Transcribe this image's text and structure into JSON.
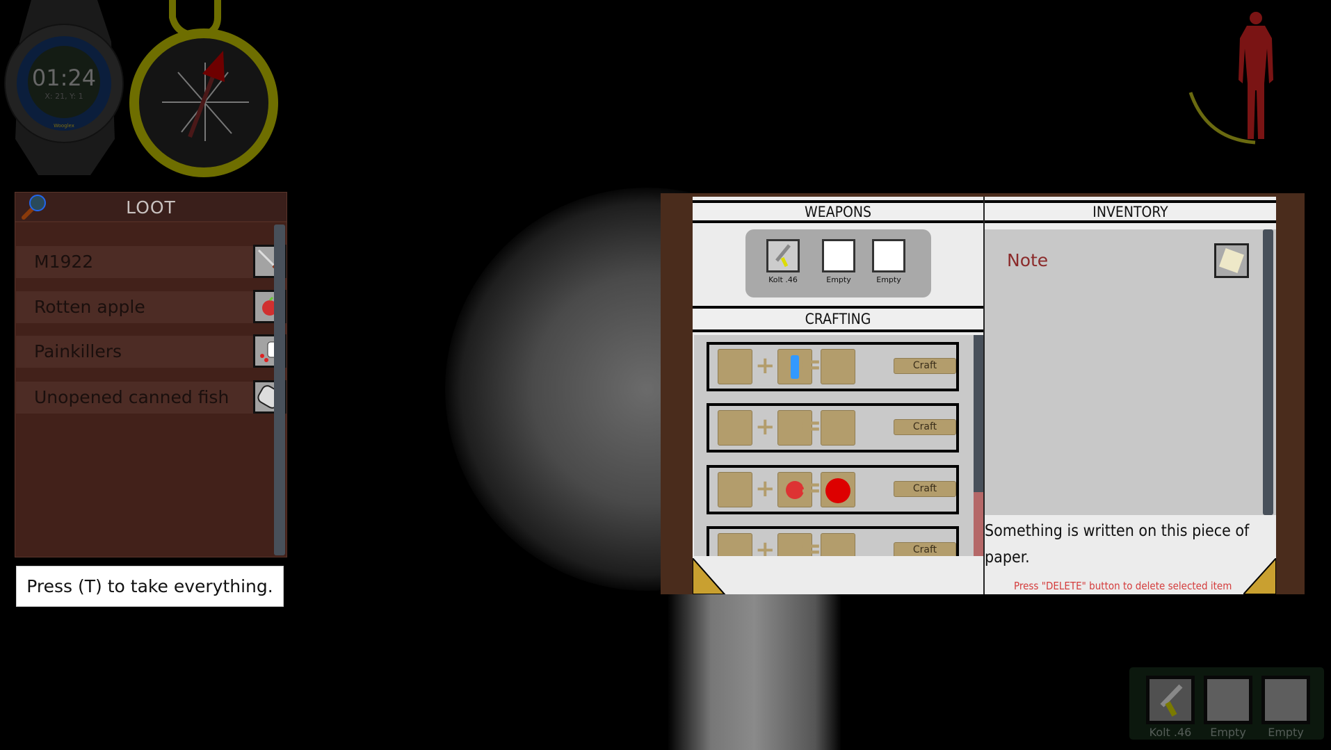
{
  "watch": {
    "time": "01:24",
    "coords": "X: 21, Y: 1",
    "brand": "Wooglex"
  },
  "loot": {
    "title": "LOOT",
    "items": [
      {
        "label": "M1922",
        "icon": "rifle-icon"
      },
      {
        "label": "Rotten apple",
        "icon": "rotten-apple-icon"
      },
      {
        "label": "Painkillers",
        "icon": "painkillers-icon"
      },
      {
        "label": "Unopened canned fish",
        "icon": "canned-fish-icon"
      }
    ],
    "hint": "Press (T) to take everything."
  },
  "weapons": {
    "title": "WEAPONS",
    "slots": [
      {
        "label": "Kolt .46",
        "icon": "pistol-icon"
      },
      {
        "label": "Empty"
      },
      {
        "label": "Empty"
      }
    ]
  },
  "crafting": {
    "title": "CRAFTING",
    "recipes": [
      {
        "inputs": [
          "bandage-icon",
          "water-bottle-icon"
        ],
        "output": "clean-bandage-icon",
        "button": "Craft"
      },
      {
        "inputs": [
          "plaster-icon",
          "plaster-icon"
        ],
        "output": "bandage-icon",
        "button": "Craft"
      },
      {
        "inputs": [
          "spray-bottle-icon",
          "rotten-apple-icon"
        ],
        "output": "apple-icon",
        "button": "Craft"
      },
      {
        "inputs": [
          "canned-fish-icon",
          "knife-icon"
        ],
        "output": "opened-can-icon",
        "button": "Craft"
      }
    ]
  },
  "inventory": {
    "title": "INVENTORY",
    "items": [
      {
        "label": "Note",
        "icon": "note-icon"
      }
    ],
    "description": "Something is written on this piece of paper.",
    "delete_hint": "Press \"DELETE\" button to delete selected item"
  },
  "hotbar": [
    {
      "label": "Kolt .46",
      "icon": "pistol-icon"
    },
    {
      "label": "Empty"
    },
    {
      "label": "Empty"
    }
  ],
  "colors": {
    "loot_bg": "#42211a",
    "book_border": "#4a2c1c",
    "craft_tan": "#b39d6c",
    "note_text": "#8b2a2a",
    "delete_text": "#d43c3c",
    "body_health": "#7a1414",
    "stamina_arc": "#6a6a10"
  }
}
